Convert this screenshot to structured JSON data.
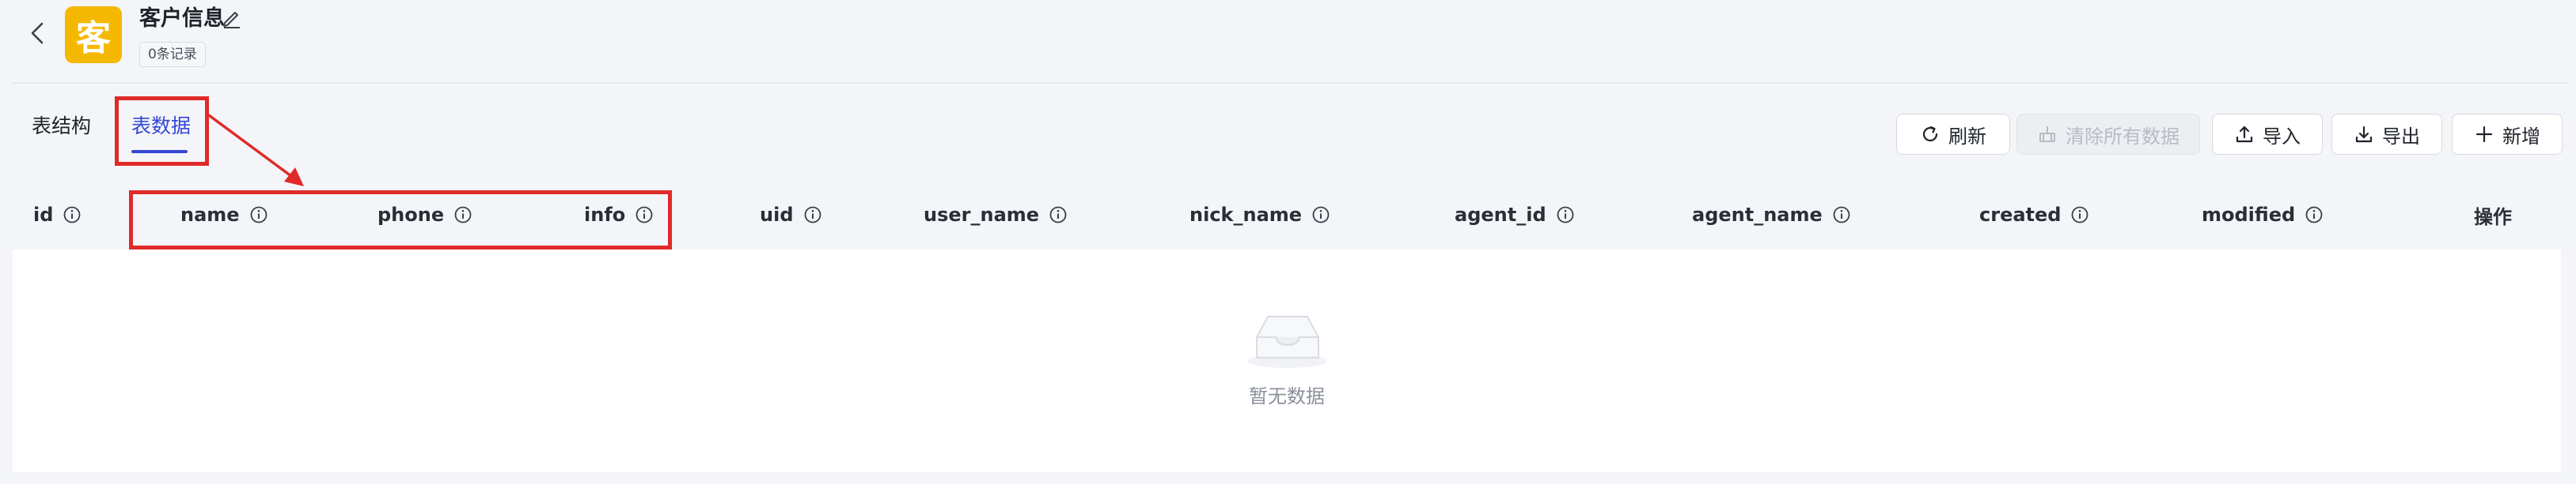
{
  "header": {
    "app_icon_char": "客",
    "title": "客户信息",
    "record_count": "0条记录"
  },
  "tabs": [
    {
      "label": "表结构",
      "active": false
    },
    {
      "label": "表数据",
      "active": true
    }
  ],
  "toolbar": {
    "refresh_label": "刷新",
    "clear_label": "清除所有数据",
    "import_label": "导入",
    "export_label": "导出",
    "add_label": "新增"
  },
  "table": {
    "columns": [
      "id",
      "name",
      "phone",
      "info",
      "uid",
      "user_name",
      "nick_name",
      "agent_id",
      "agent_name",
      "created",
      "modified"
    ],
    "actions_header": "操作",
    "empty_text": "暂无数据"
  },
  "colors": {
    "accent": "#3448d4",
    "app_icon_bg": "#f5b800",
    "annotation": "#e02a2a",
    "page_bg": "#f4f5f9"
  }
}
